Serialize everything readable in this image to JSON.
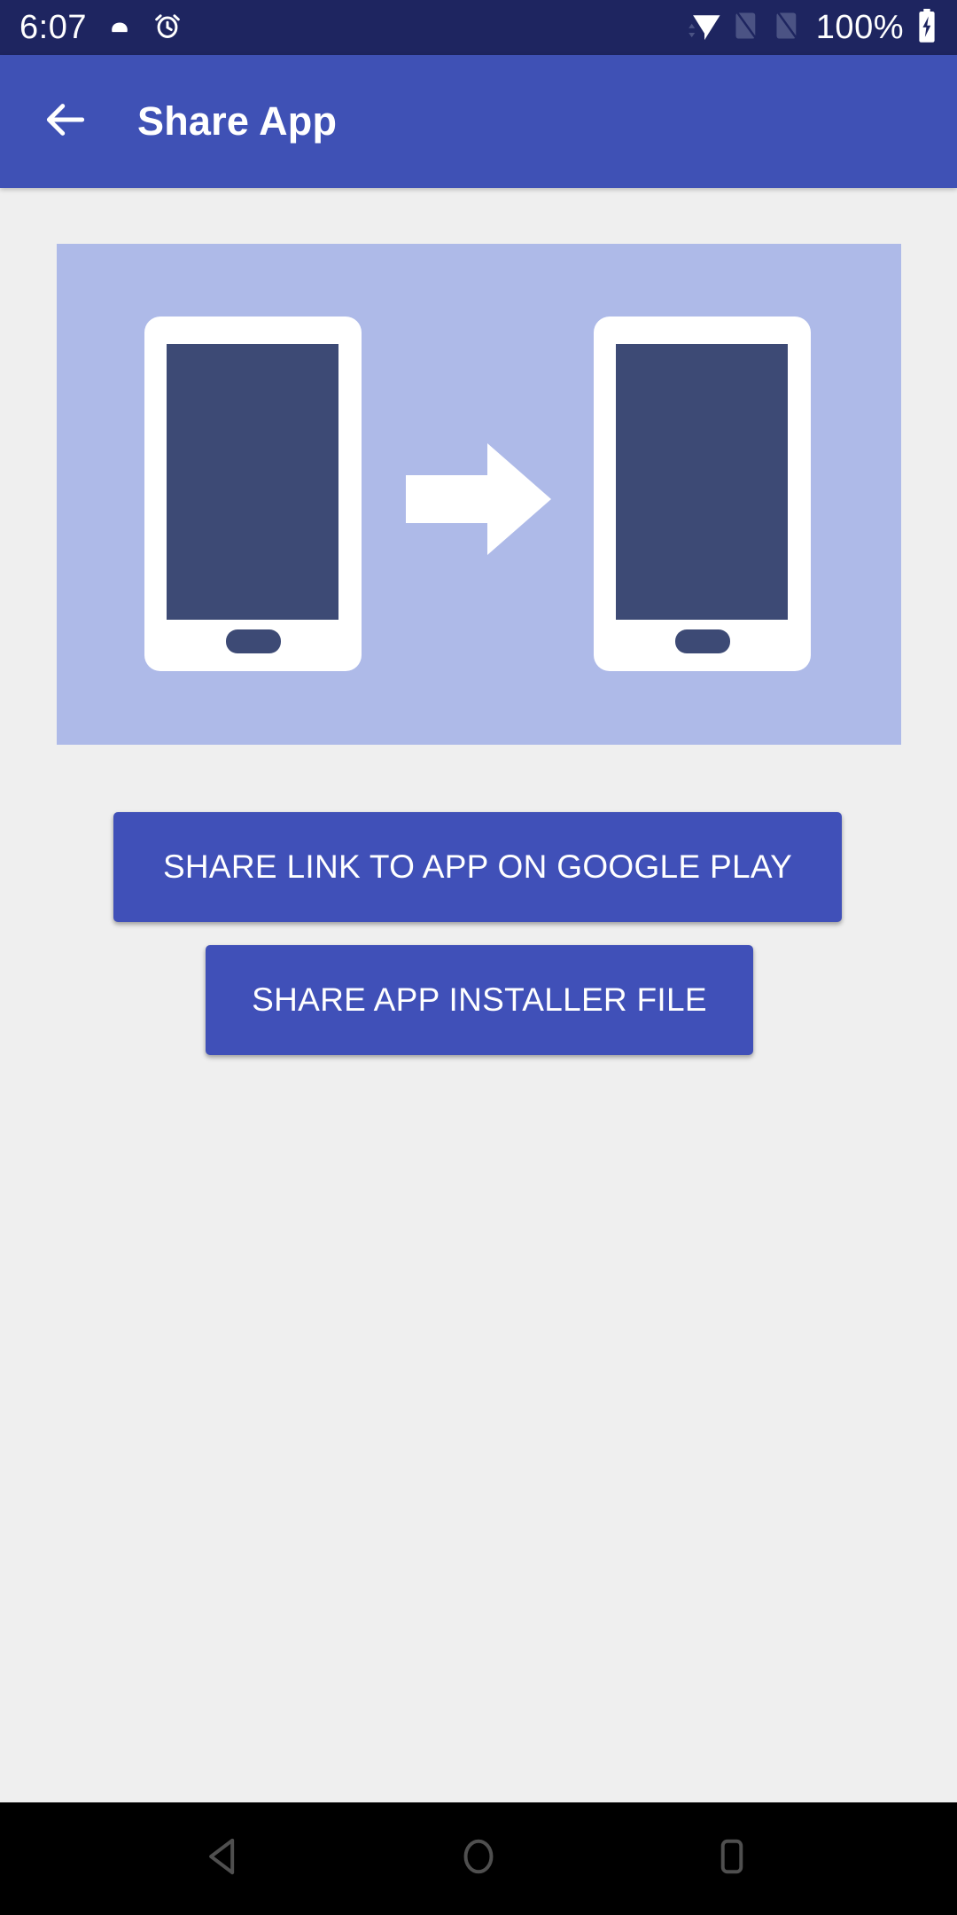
{
  "status_bar": {
    "time": "6:07",
    "battery_percent": "100%",
    "icons": {
      "notification": "cloud-icon",
      "alarm": "alarm-clock-icon",
      "wifi": "wifi-icon",
      "sim1": "no-sim-icon",
      "sim2": "no-sim-icon",
      "battery": "battery-charging-icon"
    },
    "colors": {
      "background": "#1e2560",
      "foreground": "#ffffff",
      "dimmed": "#4b5384"
    }
  },
  "app_bar": {
    "title": "Share App",
    "back_icon": "arrow-left-icon",
    "background": "#3f51b5",
    "foreground": "#ffffff"
  },
  "content": {
    "background": "#efefef",
    "illustration": {
      "name": "share-app-illustration",
      "alt": "Two phones with an arrow pointing from the left phone to the right phone",
      "background": "#aebae8",
      "phone_body_color": "#ffffff",
      "phone_screen_color": "#3d4a75",
      "arrow_color": "#ffffff"
    },
    "buttons": [
      {
        "id": "share-link-google-play",
        "label": "SHARE LINK TO APP ON GOOGLE PLAY",
        "color": "#4050b8",
        "text_color": "#ffffff"
      },
      {
        "id": "share-app-installer-file",
        "label": "SHARE APP INSTALLER FILE",
        "color": "#4050b8",
        "text_color": "#ffffff"
      }
    ]
  },
  "nav_bar": {
    "background": "#000000",
    "icon_color": "#4f4f4f",
    "keys": [
      {
        "id": "back",
        "icon": "triangle-back-icon"
      },
      {
        "id": "home",
        "icon": "circle-home-icon"
      },
      {
        "id": "recents",
        "icon": "square-recents-icon"
      }
    ]
  }
}
